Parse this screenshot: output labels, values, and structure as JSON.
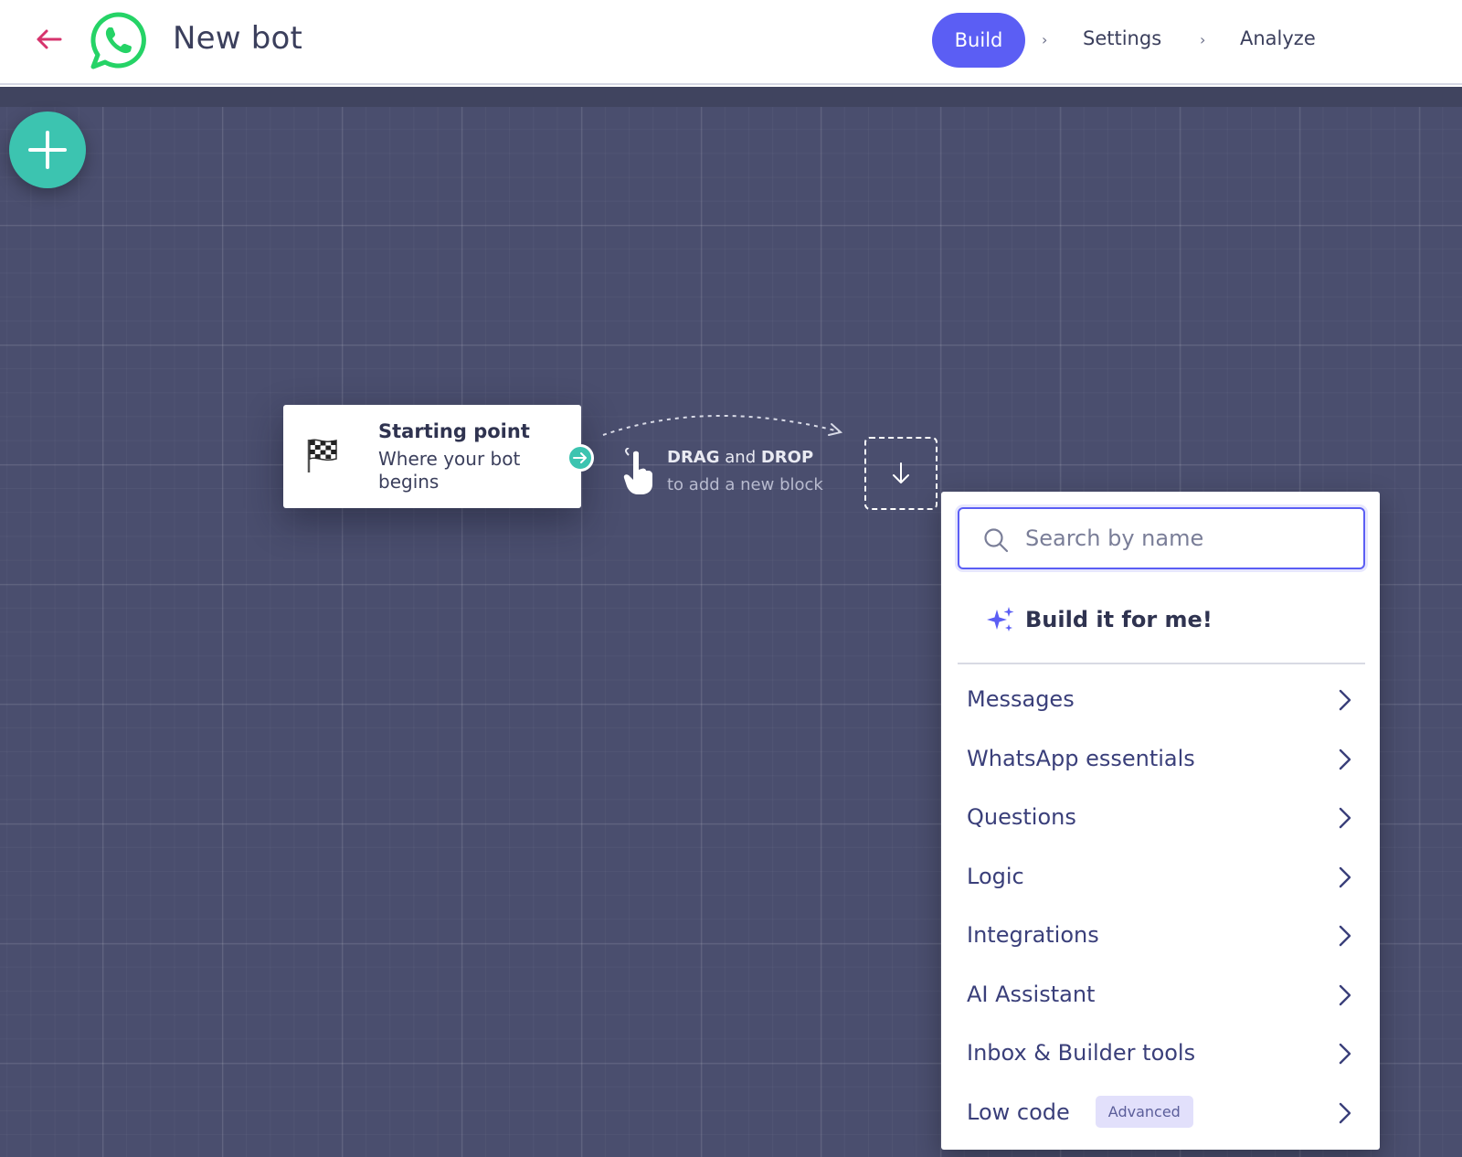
{
  "header": {
    "title": "New bot",
    "nav": {
      "build": "Build",
      "settings": "Settings",
      "analyze": "Analyze",
      "separator": "›"
    }
  },
  "colors": {
    "accent": "#5b5ef4",
    "teal": "#3cc4b0",
    "canvas": "#4a4e6e",
    "back_arrow": "#d6336c",
    "whatsapp": "#25d366"
  },
  "canvas": {
    "start_node": {
      "title": "Starting point",
      "subtitle": "Where your bot begins"
    },
    "drag_hint": {
      "drag": "DRAG",
      "and": "and",
      "drop": "DROP",
      "line2": "to add a new block"
    }
  },
  "panel": {
    "search_placeholder": "Search by name",
    "build_for_me": "Build it for me!",
    "items": [
      {
        "label": "Messages",
        "badge": ""
      },
      {
        "label": "WhatsApp essentials",
        "badge": ""
      },
      {
        "label": "Questions",
        "badge": ""
      },
      {
        "label": "Logic",
        "badge": ""
      },
      {
        "label": "Integrations",
        "badge": ""
      },
      {
        "label": "AI Assistant",
        "badge": ""
      },
      {
        "label": "Inbox & Builder tools",
        "badge": ""
      },
      {
        "label": "Low code",
        "badge": "Advanced"
      }
    ]
  }
}
